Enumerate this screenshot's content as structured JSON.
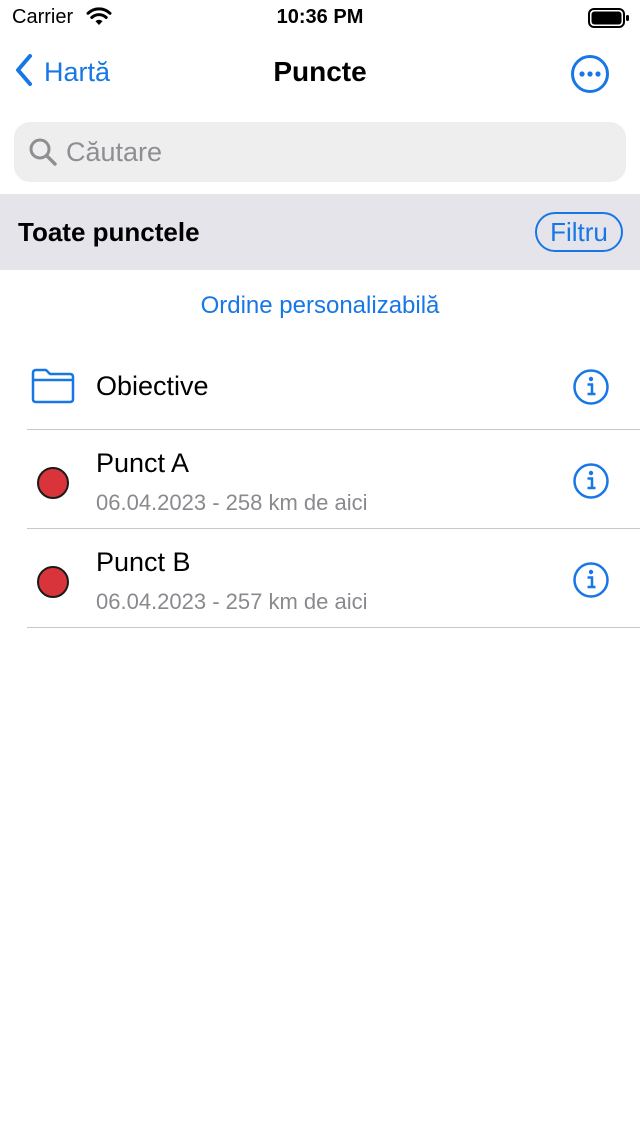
{
  "status_bar": {
    "carrier": "Carrier",
    "time": "10:36 PM"
  },
  "nav": {
    "back_label": "Hartă",
    "title": "Puncte"
  },
  "search": {
    "placeholder": "Căutare",
    "value": ""
  },
  "section": {
    "title": "Toate punctele",
    "filter_label": "Filtru"
  },
  "order_label": "Ordine personalizabilă",
  "list": [
    {
      "type": "folder",
      "title": "Obiective"
    },
    {
      "type": "point",
      "title": "Punct A",
      "subtitle": "06.04.2023 - 258 km de aici",
      "color": "#d9343a"
    },
    {
      "type": "point",
      "title": "Punct B",
      "subtitle": "06.04.2023 - 257 km de aici",
      "color": "#d9343a"
    }
  ],
  "colors": {
    "accent": "#1877e6",
    "point": "#d9343a",
    "section_bg": "#e4e4ea"
  }
}
